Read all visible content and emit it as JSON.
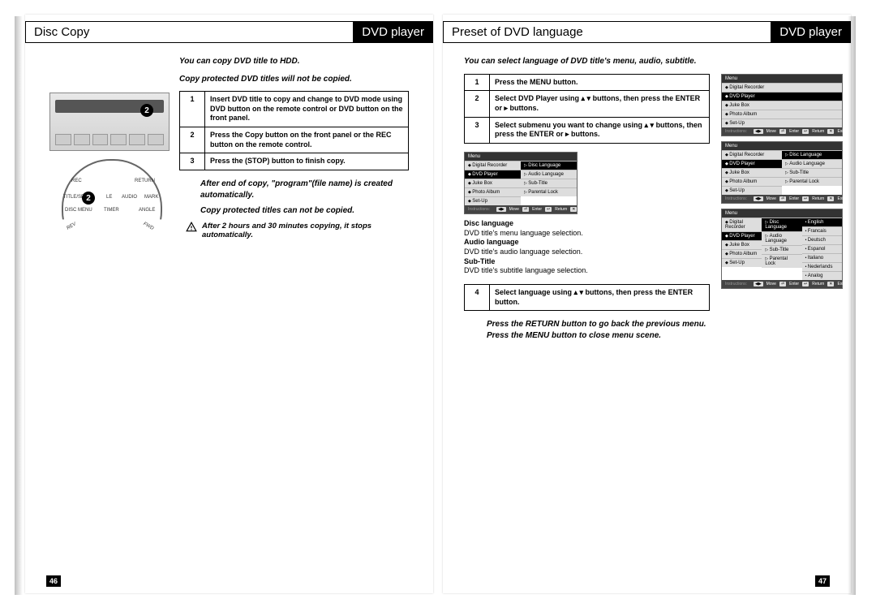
{
  "left": {
    "title": "Disc Copy",
    "badge": "DVD player",
    "intro1": "You can copy DVD title to HDD.",
    "intro2": "Copy protected DVD titles will not be copied.",
    "steps": [
      {
        "n": "1",
        "t": "Insert DVD title to copy and change to DVD mode using DVD button on the remote control or DVD button on the front panel."
      },
      {
        "n": "2",
        "t": "Press the Copy button on the front panel or the REC button on the remote control."
      },
      {
        "n": "3",
        "t": "Press the     (STOP) button to finish copy."
      }
    ],
    "note1": "After end of copy, \"program\"(file name) is created automatically.",
    "note2": "Copy protected titles can not be copied.",
    "warn": "After 2 hours and 30 minutes copying, it stops automatically.",
    "page": "46",
    "remote": {
      "rec": "REC",
      "return": "RETURN",
      "titlespeed": "TITLE/SPEED",
      "le": "LE",
      "audio": "AUDIO",
      "mark": "MARK",
      "discmenu": "DISC MENU",
      "timer": "TIMER",
      "angle": "ANGLE",
      "rev": "REV",
      "fwd": "FWD"
    },
    "callout2": "2"
  },
  "right": {
    "title": "Preset of DVD language",
    "badge": "DVD player",
    "intro": "You can select language of DVD title's menu, audio, subtitle.",
    "steps": [
      {
        "n": "1",
        "t": "Press the MENU button."
      },
      {
        "n": "2",
        "t": "Select DVD Player using  ▴  ▾ buttons, then press the ENTER or ▸ buttons."
      },
      {
        "n": "3",
        "t": "Select submenu you want to change using ▴  ▾ buttons, then press the ENTER or ▸ buttons."
      },
      {
        "n": "4",
        "t": "Select language using ▴  ▾ buttons, then press the ENTER button."
      }
    ],
    "lang": {
      "disc_h": "Disc language",
      "disc_t": "DVD title's menu language selection.",
      "audio_h": "Audio language",
      "audio_t": "DVD title's audio language selection.",
      "sub_h": "Sub-Title",
      "sub_t": "DVD title's subtitle language selection."
    },
    "closing1": "Press the RETURN button to go back the previous menu.",
    "closing2": "Press the MENU button to close menu scene.",
    "page": "47",
    "menu_items_left": [
      "Digital Recorder",
      "DVD Player",
      "Juke Box",
      "Photo Album",
      "Set-Up"
    ],
    "menu_items_mid": [
      "Disc Language",
      "Audio Language",
      "Sub-Title",
      "Parental Lock"
    ],
    "langs": [
      "English",
      "Francais",
      "Deutsch",
      "Espanol",
      "Italiano",
      "Nederlands",
      "Analog"
    ],
    "instr_move": "Move",
    "instr_enter": "Enter",
    "instr_return": "Return",
    "instr_exit": "Exit",
    "menu_hdr": "Menu"
  }
}
